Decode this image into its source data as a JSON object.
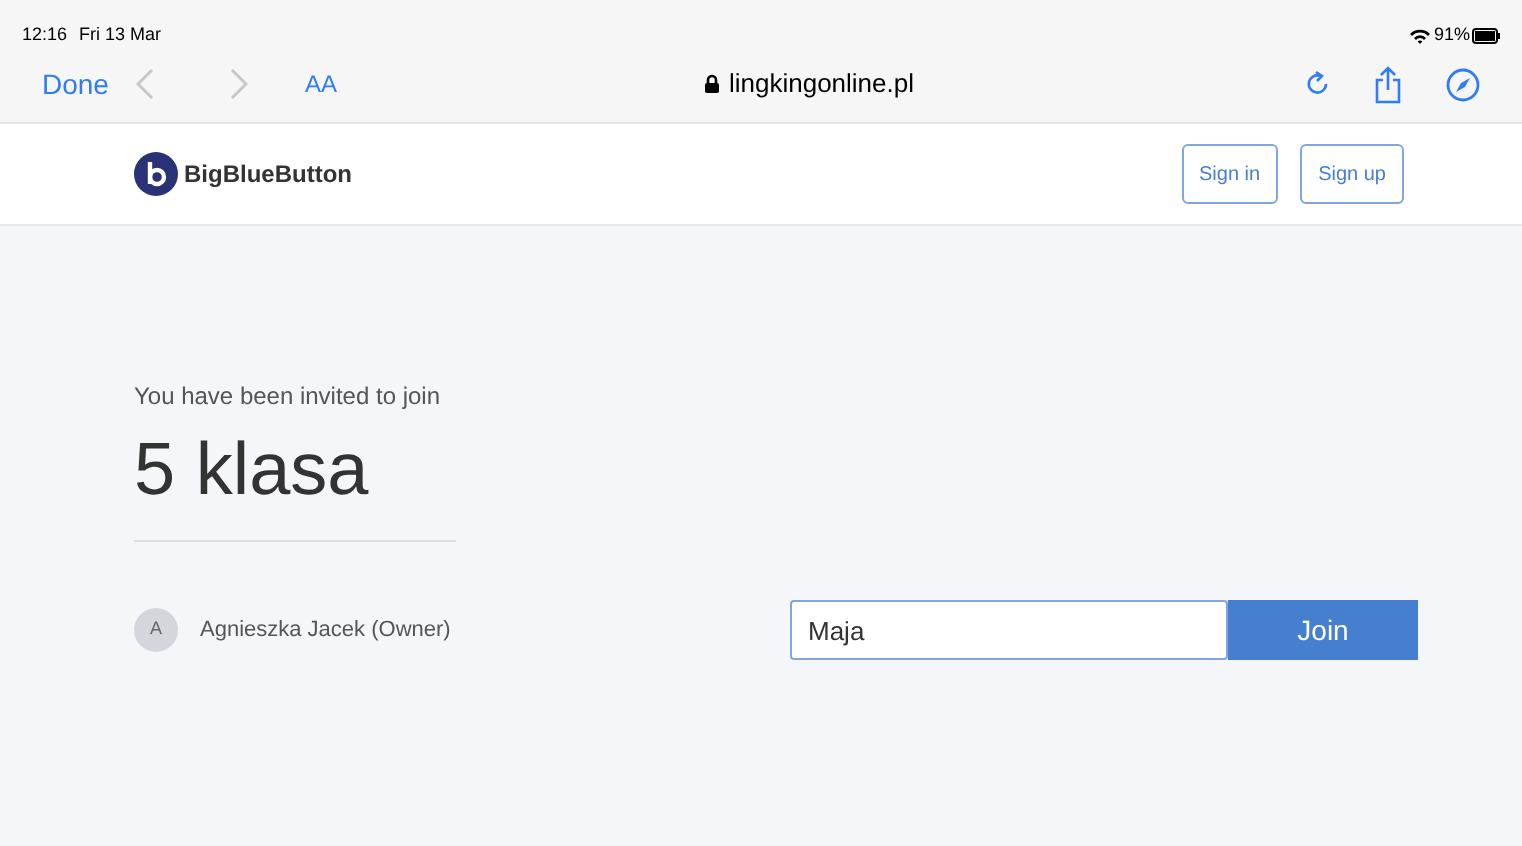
{
  "status_bar": {
    "time": "12:16",
    "date": "Fri 13 Mar",
    "battery": "91%"
  },
  "browser": {
    "done": "Done",
    "back_disabled": true,
    "forward_disabled": true,
    "text_size": "AA",
    "url": "lingkingonline.pl"
  },
  "header": {
    "logo_text": "BigBlueButton",
    "buttons": [
      "Sign in",
      "Sign up"
    ]
  },
  "room": {
    "invite": "You have been invited to join",
    "name": "5 klasa",
    "owner_initial": "A",
    "owner": "Agnieszka Jacek (Owner)"
  },
  "join": {
    "value": "Maja",
    "button": "Join"
  }
}
